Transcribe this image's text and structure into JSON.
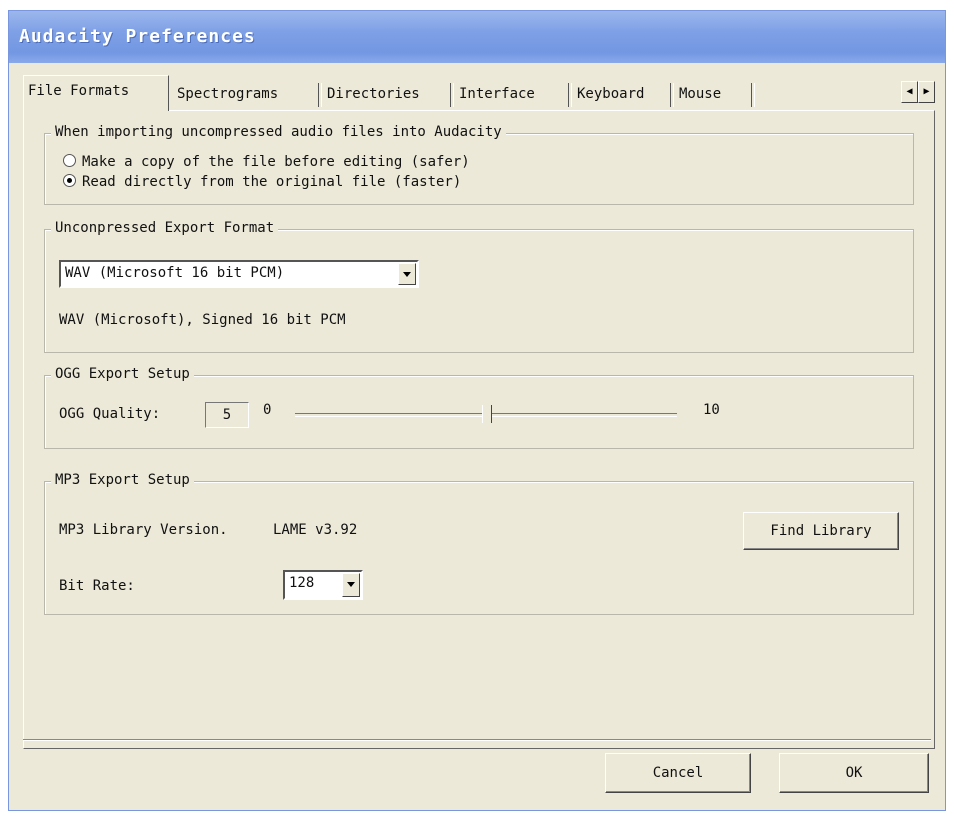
{
  "window": {
    "title": "Audacity Preferences"
  },
  "tabs": [
    {
      "label": "File Formats",
      "active": true
    },
    {
      "label": "Spectrograms",
      "active": false
    },
    {
      "label": "Directories",
      "active": false
    },
    {
      "label": "Interface",
      "active": false
    },
    {
      "label": "Keyboard",
      "active": false
    },
    {
      "label": "Mouse",
      "active": false
    }
  ],
  "tab_scroll": {
    "left_icon": "arrow-left-icon",
    "right_icon": "arrow-right-icon",
    "left_glyph": "◀",
    "right_glyph": "▶"
  },
  "import_group": {
    "legend": "When importing uncompressed audio files into Audacity",
    "options": [
      {
        "label": "Make a copy of the file before editing (safer)",
        "checked": false
      },
      {
        "label": "Read directly from the original file (faster)",
        "checked": true
      }
    ]
  },
  "export_format_group": {
    "legend": "Unconpressed Export Format",
    "selected": "WAV (Microsoft 16 bit PCM)",
    "description": "WAV (Microsoft), Signed 16 bit PCM"
  },
  "ogg_group": {
    "legend": "OGG Export Setup",
    "quality_label": "OGG Quality:",
    "quality_value": "5",
    "min_label": "0",
    "max_label": "10",
    "slider_fraction": 0.5
  },
  "mp3_group": {
    "legend": "MP3 Export Setup",
    "library_version_label": "MP3 Library Version.",
    "library_version_value": "LAME v3.92",
    "find_library_label": "Find Library",
    "bit_rate_label": "Bit Rate:",
    "bit_rate_value": "128"
  },
  "footer": {
    "cancel_label": "Cancel",
    "ok_label": "OK"
  },
  "colors": {
    "titlebar": "#7ea0e6",
    "dialog_bg": "#ece9d8"
  }
}
